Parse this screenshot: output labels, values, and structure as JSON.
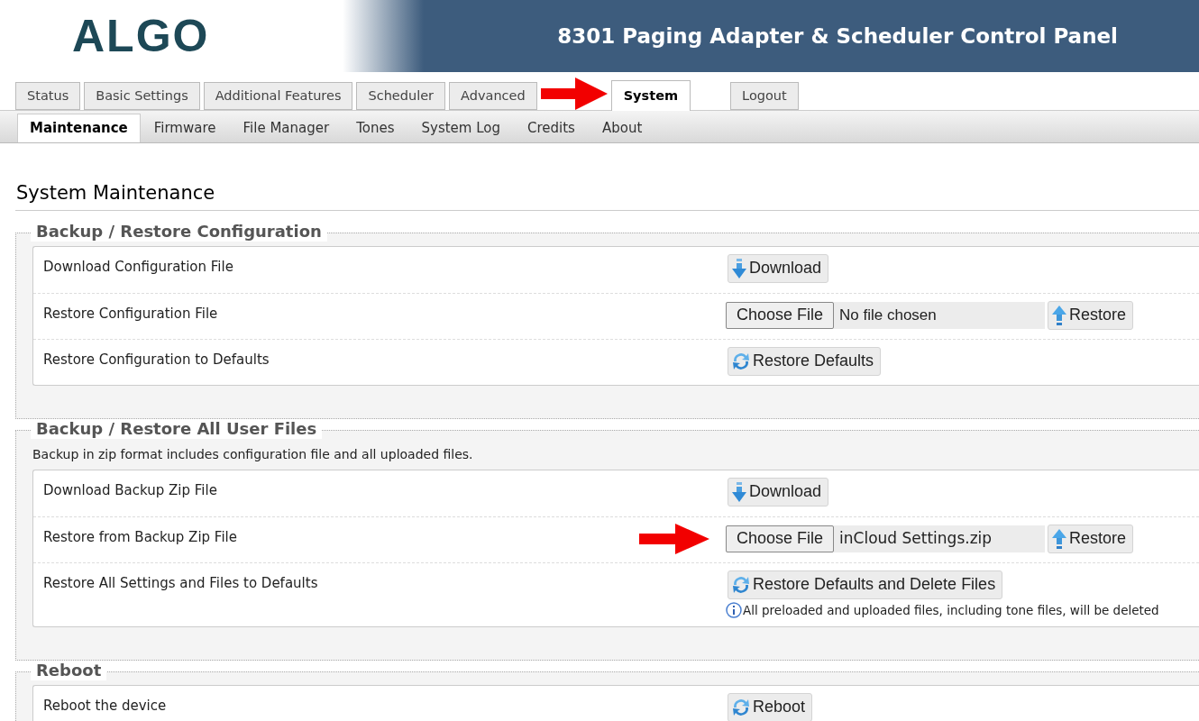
{
  "header": {
    "logo": "ALGO",
    "title": "8301 Paging Adapter & Scheduler Control Panel"
  },
  "tabs": [
    {
      "label": "Status",
      "selected": false,
      "kind": "page"
    },
    {
      "label": "Basic Settings",
      "selected": false,
      "kind": "page"
    },
    {
      "label": "Additional Features",
      "selected": false,
      "kind": "page"
    },
    {
      "label": "Scheduler",
      "selected": false,
      "kind": "page"
    },
    {
      "label": "Advanced",
      "selected": false,
      "kind": "page"
    },
    {
      "label": "System",
      "selected": true,
      "kind": "page",
      "pointed": true
    },
    {
      "label": "Logout",
      "selected": false,
      "kind": "action"
    }
  ],
  "subtabs": [
    {
      "label": "Maintenance",
      "selected": true
    },
    {
      "label": "Firmware",
      "selected": false
    },
    {
      "label": "File Manager",
      "selected": false
    },
    {
      "label": "Tones",
      "selected": false
    },
    {
      "label": "System Log",
      "selected": false
    },
    {
      "label": "Credits",
      "selected": false
    },
    {
      "label": "About",
      "selected": false
    }
  ],
  "page_title": "System Maintenance",
  "sections": [
    {
      "title": "Backup / Restore Configuration",
      "rows": [
        {
          "label": "Download Configuration File",
          "kind": "download",
          "button": "Download"
        },
        {
          "label": "Restore Configuration File",
          "kind": "file",
          "choose": "Choose File",
          "file": "No file chosen",
          "button": "Restore"
        },
        {
          "label": "Restore Configuration to Defaults",
          "kind": "reset",
          "button": "Restore Defaults"
        }
      ]
    },
    {
      "title": "Backup / Restore All User Files",
      "description": "Backup in zip format includes configuration file and all uploaded files.",
      "rows": [
        {
          "label": "Download Backup Zip File",
          "kind": "download",
          "button": "Download"
        },
        {
          "label": "Restore from Backup Zip File",
          "kind": "file",
          "choose": "Choose File",
          "file": "inCloud Settings.zip",
          "button": "Restore",
          "pointed": true
        },
        {
          "label": "Restore All Settings and Files to Defaults",
          "kind": "reset",
          "button": "Restore Defaults and Delete Files",
          "note": "All preloaded and uploaded files, including tone files, will be deleted"
        }
      ]
    },
    {
      "title": "Reboot",
      "rows": [
        {
          "label": "Reboot the device",
          "kind": "reset",
          "button": "Reboot"
        }
      ]
    }
  ]
}
